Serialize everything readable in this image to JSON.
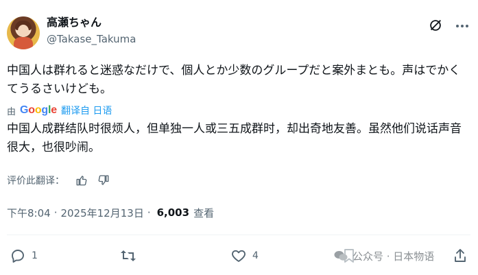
{
  "user": {
    "display_name": "高瀬ちゃん",
    "handle": "@Takase_Takuma"
  },
  "post": {
    "original_text": "中国人は群れると迷惑なだけで、個人とか少数のグループだと案外まとも。声はでかくてうるさいけども。",
    "translated_by": "由",
    "translate_provider": [
      "G",
      "o",
      "o",
      "g",
      "l",
      "e"
    ],
    "translate_link": "翻译自 日语",
    "translated_text": "中国人成群结队时很烦人，但单独一人或三五成群时，却出奇地友善。虽然他们说话声音很大，也很吵闹。",
    "rate_label": "评价此翻译：",
    "time": "下午8:04",
    "date": "2025年12月13日",
    "separator": "·",
    "views_count": "6,003",
    "views_label": "查看"
  },
  "actions": {
    "reply_count": "1",
    "like_count": "4"
  },
  "watermark": {
    "text": "公众号 · 日本物语"
  },
  "colors": {
    "text": "#0f1419",
    "secondary": "#536471",
    "link": "#1d9bf0"
  }
}
